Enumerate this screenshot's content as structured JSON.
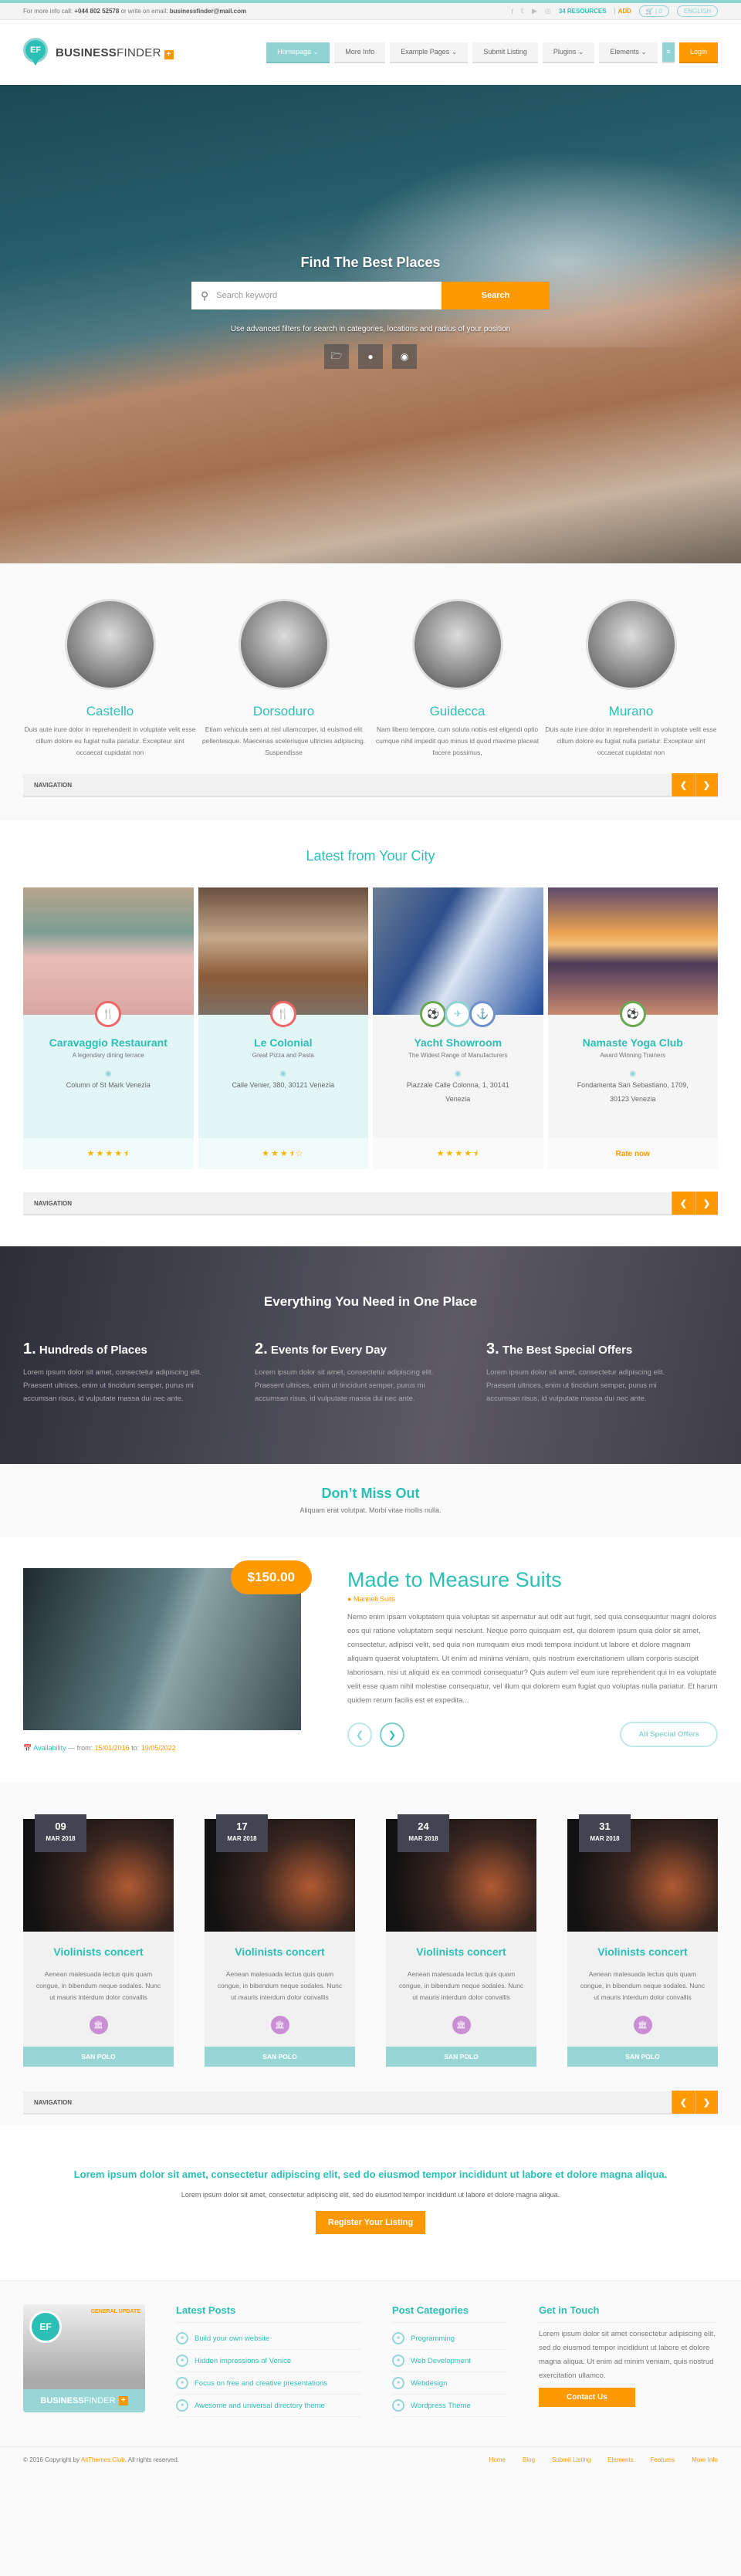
{
  "topbar": {
    "info_prefix": "For more info call:",
    "phone": "+044 802 52578",
    "info_mid": "or write on email:",
    "email": "businessfinder@mail.com",
    "social": [
      "f",
      "t",
      "yt",
      "dr"
    ],
    "resources": "34 RESOURCES",
    "add": "ADD",
    "cart": "0",
    "language": "ENGLISH"
  },
  "header": {
    "logo_initials": "EF",
    "logo_bold": "BUSINESS",
    "logo_light": "FINDER",
    "nav": [
      {
        "label": "Homepage ⌄",
        "active": true
      },
      {
        "label": "More Info"
      },
      {
        "label": "Example Pages ⌄"
      },
      {
        "label": "Submit Listing"
      },
      {
        "label": "Plugins ⌄"
      },
      {
        "label": "Elements ⌄"
      }
    ],
    "menu_icon": "≡",
    "login": "Login"
  },
  "hero": {
    "title": "Find The Best Places",
    "search_placeholder": "Search keyword",
    "search_button": "Search",
    "subtitle": "Use advanced filters for search in categories, locations and radius of your position",
    "filters": [
      "folder-icon",
      "location-pin-icon",
      "radius-icon"
    ]
  },
  "districts": [
    {
      "name": "Castello",
      "text": "Duis aute irure dolor in reprehenderit in voluptate velit esse cillum dolore eu fugiat nulla pariatur. Excepteur sint occaecat cupidatat non"
    },
    {
      "name": "Dorsoduro",
      "text": "Etiam vehicula sem at nisl ullamcorper, id euismod elit pellentesque. Maecenas scelerisque ultricies adipiscing. Suspendisse"
    },
    {
      "name": "Guidecca",
      "text": "Nam libero tempore, cum soluta nobis est eligendi optio cumque nihil impedit quo minus id quod maxime placeat facere possimus,"
    },
    {
      "name": "Murano",
      "text": "Duis aute irure dolor in reprehenderit in voluptate velit esse cillum dolore eu fugiat nulla pariatur. Excepteur sint occaecat cupidatat non"
    }
  ],
  "navigation_label": "NAVIGATION",
  "latest": {
    "title": "Latest from Your City",
    "cards": [
      {
        "title": "Caravaggio Restaurant",
        "tagline": "A legendary dining terrace",
        "address": "Column of St Mark Venezia",
        "rating": 4.5,
        "stars": "★★★★⯨",
        "rate_text": ""
      },
      {
        "title": "Le Colonial",
        "tagline": "Great Pizza and Pasta",
        "address": "Calle Venier, 380, 30121 Venezia",
        "rating": 3.5,
        "stars": "★★★⯨☆",
        "rate_text": ""
      },
      {
        "title": "Yacht Showroom",
        "tagline": "The Widest Range of Manufacturers",
        "address": "Piazzale Calle Colonna, 1, 30141 Venezia",
        "rating": 4.5,
        "stars": "★★★★⯨",
        "rate_text": ""
      },
      {
        "title": "Namaste Yoga Club",
        "tagline": "Award Winning Trainers",
        "address": "Fondamenta San Sebastiano, 1709, 30123 Venezia",
        "rating": null,
        "stars": "",
        "rate_text": "Rate now"
      }
    ]
  },
  "everything": {
    "title": "Everything You Need in One Place",
    "items": [
      {
        "num": "1.",
        "title": "Hundreds of Places",
        "text": "Lorem ipsum dolor sit amet, consectetur adipiscing elit. Praesent ultrices, enim ut tincidunt semper, purus mi accumsan risus, id vulputate massa dui nec ante."
      },
      {
        "num": "2.",
        "title": "Events for Every Day",
        "text": "Lorem ipsum dolor sit amet, consectetur adipiscing elit. Praesent ultrices, enim ut tincidunt semper, purus mi accumsan risus, id vulputate massa dui nec ante."
      },
      {
        "num": "3.",
        "title": "The Best Special Offers",
        "text": "Lorem ipsum dolor sit amet, consectetur adipiscing elit. Praesent ultrices, enim ut tincidunt semper, purus mi accumsan risus, id vulputate massa dui nec ante."
      }
    ]
  },
  "dont_miss": {
    "title": "Don’t Miss Out",
    "subtitle": "Aliquam erat volutpat. Morbi vitae mollis nulla."
  },
  "offer": {
    "price": "$150.00",
    "title": "Made to Measure Suits",
    "location": "Manneli Suits",
    "description": "Nemo enim ipsam voluptatem quia voluptas sit aspernatur aut odit aut fugit, sed quia consequuntur magni dolores eos qui ratione voluptatem sequi nesciunt. Neque porro quisquam est, qui dolorem ipsum quia dolor sit amet, consectetur, adipisci velit, sed quia non numquam eius modi tempora incidunt ut labore et dolore magnam aliquam quaerat voluptatem. Ut enim ad minima veniam, quis nostrum exercitationem ullam corporis suscipit laboriosam, nisi ut aliquid ex ea commodi consequatur? Quis autem vel eum iure reprehenderit qui in ea voluptate velit esse quam nihil molestiae consequatur, vel illum qui dolorem eum fugiat quo voluptas nulla pariatur. Et harum quidem rerum facilis est et expedita...",
    "availability_label": "Availability",
    "from_label": "— from:",
    "from_date": "15/01/2016",
    "to_label": "to:",
    "to_date": "19/05/2022",
    "all_button": "All Special Offers"
  },
  "events": [
    {
      "day": "09",
      "month": "MAR 2018",
      "title": "Violinists concert",
      "text": "Aenean malesuada lectus quis quam congue, in bibendum neque sodales. Nunc ut mauris interdum dolor convallis",
      "location": "SAN POLO"
    },
    {
      "day": "17",
      "month": "MAR 2018",
      "title": "Violinists concert",
      "text": "Aenean malesuada lectus quis quam congue, in bibendum neque sodales. Nunc ut mauris interdum dolor convallis",
      "location": "SAN POLO"
    },
    {
      "day": "24",
      "month": "MAR 2018",
      "title": "Violinists concert",
      "text": "Aenean malesuada lectus quis quam congue, in bibendum neque sodales. Nunc ut mauris interdum dolor convallis",
      "location": "SAN POLO"
    },
    {
      "day": "31",
      "month": "MAR 2018",
      "title": "Violinists concert",
      "text": "Aenean malesuada lectus quis quam congue, in bibendum neque sodales. Nunc ut mauris interdum dolor convallis",
      "location": "SAN POLO"
    }
  ],
  "cta": {
    "headline": "Lorem ipsum dolor sit amet, consectetur adipiscing elit, sed do eiusmod tempor incididunt ut labore et dolore magna aliqua.",
    "text": "Lorem ipsum dolor sit amet, consectetur adipiscing elit, sed do eiusmod tempor incididunt ut labore et dolore magna aliqua.",
    "button": "Register Your Listing"
  },
  "footer": {
    "box_badge": "GENERAL UPDATE",
    "latest_posts_title": "Latest Posts",
    "latest_posts": [
      "Build your own website",
      "Hidden impressions of Venice",
      "Focus on free and creative presentations",
      "Awesome and universal directory theme"
    ],
    "categories_title": "Post Categories",
    "categories": [
      "Programming",
      "Web Development",
      "Webdesign",
      "Wordpress Theme"
    ],
    "touch_title": "Get in Touch",
    "touch_text": "Lorem ipsum dolor sit amet consectetur adipiscing elit, sed do eiusmod tempor incididunt ut labore et dolore magna aliqua. Ut enim ad minim veniam, quis nostrud exercitation ullamco.",
    "contact_button": "Contact Us",
    "copyright_prefix": "© 2016 Copyright by",
    "copyright_org": "AitThemes.Club",
    "copyright_suffix": ". All rights reserved.",
    "links": [
      "Home",
      "Blog",
      "Submit Listing",
      "Elements",
      "Features",
      "More Info"
    ]
  },
  "colors": {
    "accent": "#2cbfb6",
    "accent_light": "#8fd3d3",
    "orange": "#ff9900",
    "dark": "#434451"
  }
}
